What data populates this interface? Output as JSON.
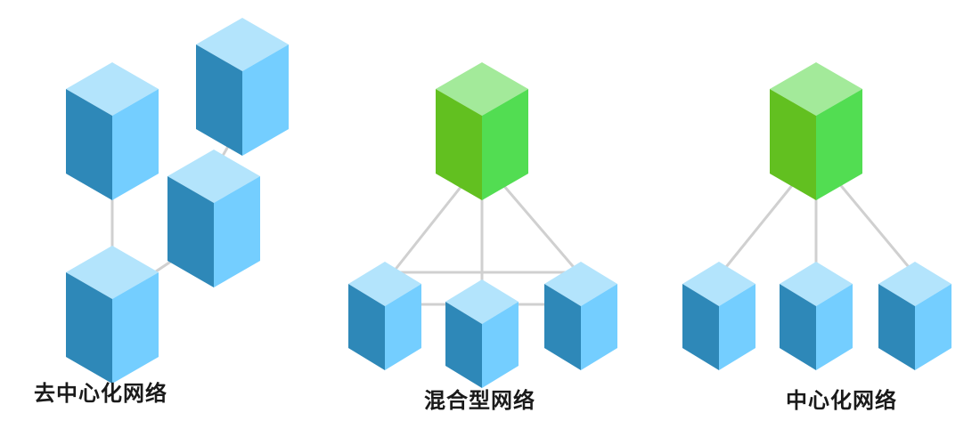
{
  "colors": {
    "blue_top": "#b3e4fc",
    "blue_left": "#2e88b8",
    "blue_right": "#74ceff",
    "green_top": "#a3ea9a",
    "green_left": "#62c020",
    "green_right": "#52dd52",
    "link": "#d0d0d0",
    "caption": "#1a1a1a"
  },
  "diagrams": [
    {
      "id": "decentralized",
      "caption": "去中心化网络"
    },
    {
      "id": "hybrid",
      "caption": "混合型网络"
    },
    {
      "id": "centralized",
      "caption": "中心化网络"
    }
  ]
}
